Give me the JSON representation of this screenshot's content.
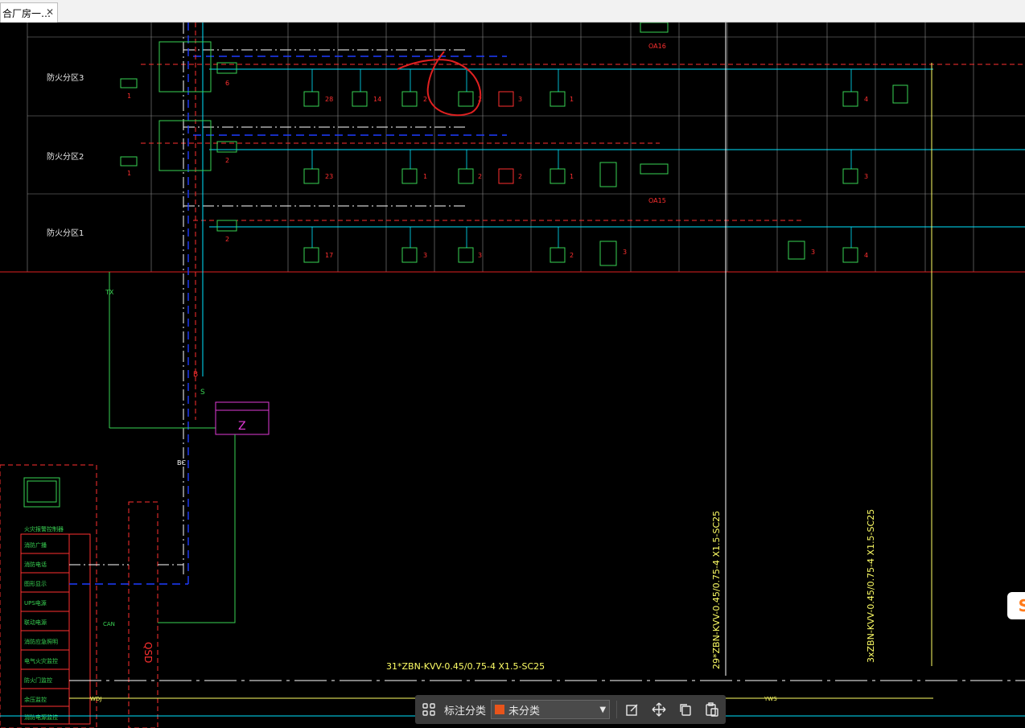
{
  "tab": {
    "title": "合厂房一…",
    "close_glyph": "✕"
  },
  "drawing": {
    "row_labels": [
      "防火分区3",
      "防火分区2",
      "防火分区1"
    ],
    "cable_bottom": "31*ZBN-KVV-0.45/0.75-4 X1.5-SC25",
    "cable_vertical_1": "29*ZBN-KVV-0.45/0.75-4 X1.5-SC25",
    "cable_vertical_2": "3xZBN-KVV-0.45/0.75-4 X1.5-SC25",
    "panel_label": "Z",
    "qsd_label": "QSD",
    "s_label": "S",
    "b_label": "B",
    "bc_label": "BC",
    "tx_label": "TX",
    "can_label": "CAN",
    "wdj_label": "WDJ",
    "yws_label": "YWS",
    "oa_top": "OA16",
    "oa_mid": "OA15",
    "counts_row3": [
      "1",
      "6",
      "28",
      "14",
      "2",
      "2",
      "3",
      "1",
      "4"
    ],
    "counts_row2": [
      "1",
      "2",
      "23",
      "1",
      "2",
      "2",
      "1",
      "3"
    ],
    "counts_row1": [
      "2",
      "17",
      "3",
      "3",
      "2",
      "3",
      "3",
      "4"
    ],
    "left_list": [
      "火灾报警控制器",
      "消防广播",
      "消防电话",
      "图形显示",
      "UPS电源",
      "联动电源",
      "消防应急照明",
      "电气火灾监控",
      "防火门监控",
      "余压监控",
      "消防电源监控"
    ]
  },
  "toolbar": {
    "label": "标注分类",
    "select_value": "未分类",
    "swatch_color": "#e8541b"
  },
  "side_badge": {
    "text": "S"
  }
}
